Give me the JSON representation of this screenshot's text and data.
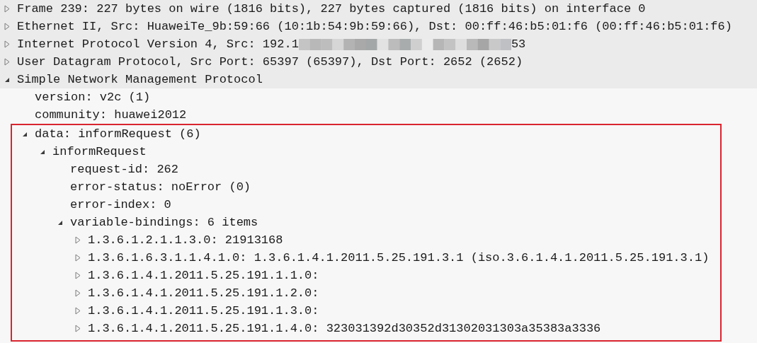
{
  "tree": [
    {
      "label": "Frame 239: 227 bytes on wire (1816 bits), 227 bytes captured (1816 bits) on interface 0",
      "kind": "toggle",
      "expanded": false
    },
    {
      "label": "Ethernet II, Src: HuaweiTe_9b:59:66 (10:1b:54:9b:59:66), Dst: 00:ff:46:b5:01:f6 (00:ff:46:b5:01:f6)",
      "kind": "toggle",
      "expanded": false
    },
    {
      "label": "Internet Protocol Version 4, Src: 192.1",
      "redacted": true,
      "label_after_redaction": "53",
      "kind": "toggle",
      "expanded": false
    },
    {
      "label": "User Datagram Protocol, Src Port: 65397 (65397), Dst Port: 2652 (2652)",
      "kind": "toggle",
      "expanded": false
    },
    {
      "label": "Simple Network Management Protocol",
      "kind": "toggle",
      "expanded": true,
      "children": [
        {
          "label": "version: v2c (1)",
          "kind": "leaf"
        },
        {
          "label": "community: huawei2012",
          "kind": "leaf"
        },
        {
          "label": "data: informRequest (6)",
          "kind": "toggle",
          "expanded": true,
          "highlighted": true,
          "children": [
            {
              "label": "informRequest",
              "kind": "toggle",
              "expanded": true,
              "children": [
                {
                  "label": "request-id: 262",
                  "kind": "leaf"
                },
                {
                  "label": "error-status: noError (0)",
                  "kind": "leaf"
                },
                {
                  "label": "error-index: 0",
                  "kind": "leaf"
                },
                {
                  "label": "variable-bindings: 6 items",
                  "kind": "toggle",
                  "expanded": true,
                  "children": [
                    {
                      "label": "1.3.6.1.2.1.1.3.0: 21913168",
                      "kind": "toggle",
                      "expanded": false
                    },
                    {
                      "label": "1.3.6.1.6.3.1.1.4.1.0: 1.3.6.1.4.1.2011.5.25.191.3.1 (iso.3.6.1.4.1.2011.5.25.191.3.1)",
                      "kind": "toggle",
                      "expanded": false
                    },
                    {
                      "label": "1.3.6.1.4.1.2011.5.25.191.1.1.0:",
                      "kind": "toggle",
                      "expanded": false
                    },
                    {
                      "label": "1.3.6.1.4.1.2011.5.25.191.1.2.0:",
                      "kind": "toggle",
                      "expanded": false
                    },
                    {
                      "label": "1.3.6.1.4.1.2011.5.25.191.1.3.0:",
                      "kind": "toggle",
                      "expanded": false
                    },
                    {
                      "label": "1.3.6.1.4.1.2011.5.25.191.1.4.0: 323031392d30352d31302031303a35383a3336",
                      "kind": "toggle",
                      "expanded": false
                    }
                  ]
                }
              ]
            }
          ]
        }
      ]
    }
  ]
}
